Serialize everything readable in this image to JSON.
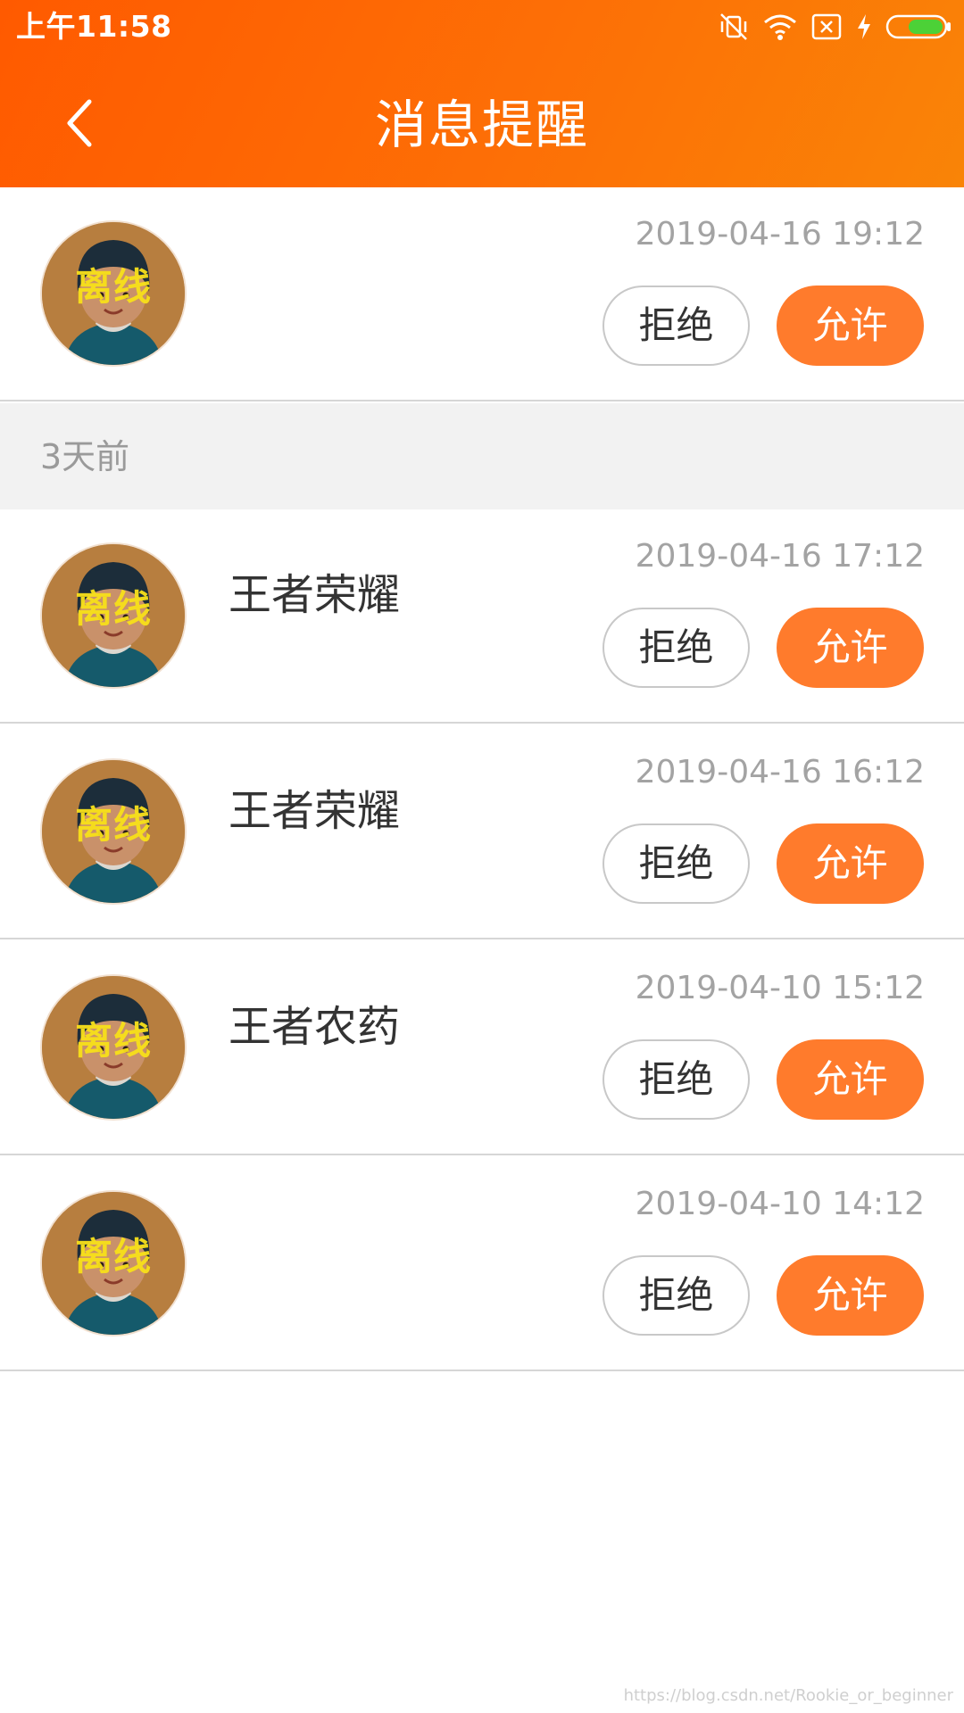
{
  "status_bar": {
    "time": "上午11:58",
    "icons": [
      "vibrate-mute-icon",
      "wifi-icon",
      "no-sim-icon",
      "charging-icon",
      "battery-icon"
    ]
  },
  "header": {
    "title": "消息提醒",
    "back_icon": "chevron-left-icon"
  },
  "colors": {
    "header_start": "#ff5a00",
    "header_end": "#f98407",
    "accent": "#ff7b2c",
    "avatar_badge": "#f8e11a",
    "time_text": "#a3a3a3"
  },
  "avatar_status": "离线",
  "buttons": {
    "reject": "拒绝",
    "allow": "允许"
  },
  "top_item": {
    "name": "",
    "time": "2019-04-16 19:12"
  },
  "section_label": "3天前",
  "items": [
    {
      "name": "王者荣耀",
      "time": "2019-04-16 17:12"
    },
    {
      "name": "王者荣耀",
      "time": "2019-04-16 16:12"
    },
    {
      "name": "王者农药",
      "time": "2019-04-10 15:12"
    },
    {
      "name": "",
      "time": "2019-04-10 14:12"
    }
  ],
  "watermark": "https://blog.csdn.net/Rookie_or_beginner"
}
